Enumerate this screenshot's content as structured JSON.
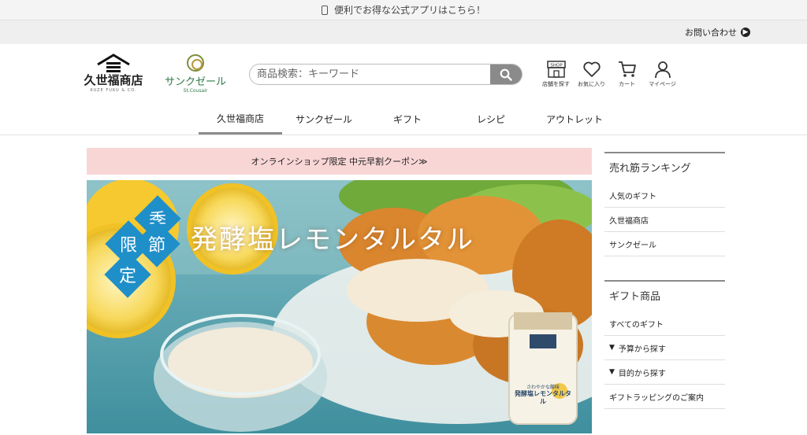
{
  "topbar": {
    "app_banner": "便利でお得な公式アプリはこちら！"
  },
  "contact": {
    "label": "お問い合わせ"
  },
  "logos": {
    "kuze": {
      "name": "久世福商店",
      "sub": "KUZE FUKU & CO."
    },
    "stcousair": {
      "name": "サンクゼール",
      "sub": "St.Cousair"
    }
  },
  "search": {
    "placeholder": "商品検索：キーワード"
  },
  "header_icons": [
    {
      "icon": "shop-icon",
      "label": "店舗を探す"
    },
    {
      "icon": "heart-icon",
      "label": "お気に入り"
    },
    {
      "icon": "cart-icon",
      "label": "カート"
    },
    {
      "icon": "person-icon",
      "label": "マイページ"
    }
  ],
  "nav": {
    "tabs": [
      {
        "label": "久世福商店",
        "active": true
      },
      {
        "label": "サンクゼール",
        "active": false
      },
      {
        "label": "ギフト",
        "active": false
      },
      {
        "label": "レシピ",
        "active": false
      },
      {
        "label": "アウトレット",
        "active": false
      }
    ]
  },
  "coupon": {
    "label": "オンラインショップ限定 中元早割クーポン≫"
  },
  "hero": {
    "title": "発酵塩レモンタルタル",
    "badge": [
      "季",
      "節",
      "限",
      "定"
    ],
    "jar_line1": "さわやかな酸味",
    "jar_line2": "発酵塩レモンタルタル"
  },
  "sidebar": {
    "ranking": {
      "heading": "売れ筋ランキング",
      "items": [
        "人気のギフト",
        "久世福商店",
        "サンクゼール"
      ]
    },
    "gift": {
      "heading": "ギフト商品",
      "items": [
        {
          "label": "すべてのギフト",
          "chevron": false
        },
        {
          "label": "予算から探す",
          "chevron": true
        },
        {
          "label": "目的から探す",
          "chevron": true
        },
        {
          "label": "ギフトラッピングのご案内",
          "chevron": false
        }
      ]
    }
  },
  "colors": {
    "coupon_bg": "#f9d6d6",
    "badge_blue": "#1f8fc9",
    "brand_green": "#2b7a45"
  }
}
